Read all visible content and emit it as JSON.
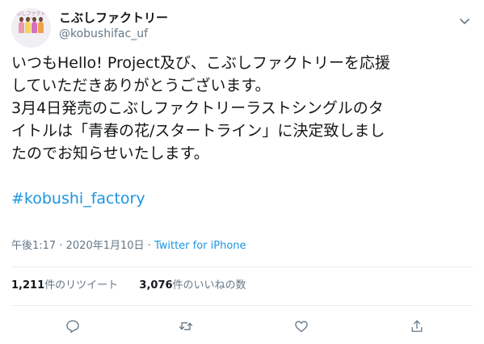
{
  "author": {
    "display_name": "こぶしファクトリー",
    "handle": "@kobushifac_uf",
    "avatar_logo": "こぶしファクトリー"
  },
  "tweet": {
    "line1": "いつもHello! Project及び、こぶしファクトリーを応援",
    "line2": "していただきありがとうございます。",
    "line3": "3月4日発売のこぶしファクトリーラストシングルのタ",
    "line4": "イトルは「青春の花/スタートライン」に決定致しまし",
    "line5": "たのでお知らせいたします。",
    "hashtag": "#kobushi_factory"
  },
  "meta": {
    "time": "午後1:17",
    "separator": "·",
    "date": "2020年1月10日",
    "source": "Twitter for iPhone"
  },
  "stats": {
    "retweets_count": "1,211",
    "retweets_label": "件のリツイート",
    "likes_count": "3,076",
    "likes_label": "件のいいねの数"
  },
  "icons": {
    "caret": "chevron-down-icon",
    "reply": "reply-icon",
    "retweet": "retweet-icon",
    "like": "heart-icon",
    "share": "share-icon"
  },
  "colors": {
    "link": "#1b95e0",
    "muted": "#657786",
    "text": "#14171a",
    "divider": "#e6ecf0"
  }
}
